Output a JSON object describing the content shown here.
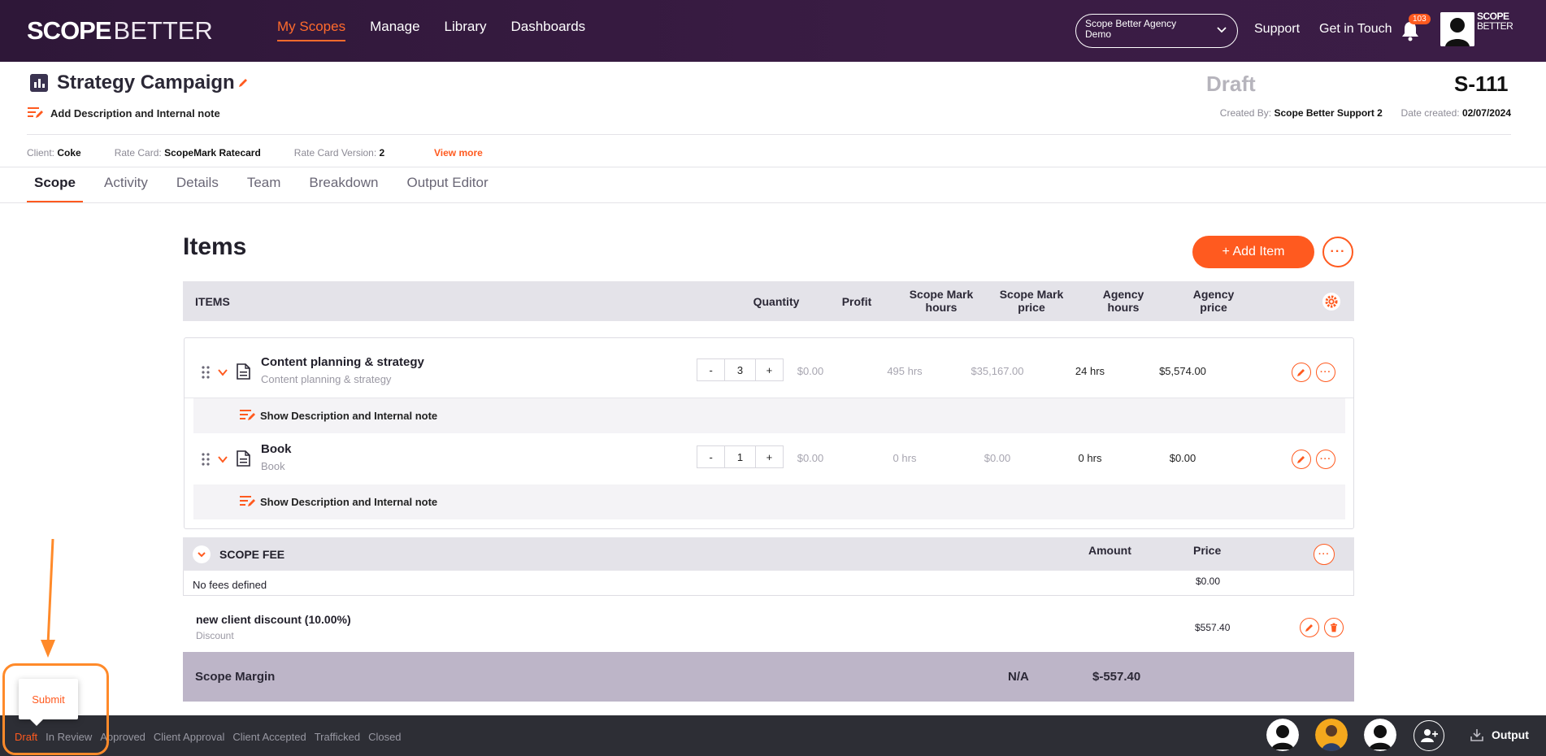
{
  "brand": {
    "logo_main": "SCOPE",
    "logo_rest": "BETTER",
    "mini_line1": "SCOPE",
    "mini_line2": "BETTER"
  },
  "nav": [
    {
      "label": "My Scopes",
      "active": true
    },
    {
      "label": "Manage"
    },
    {
      "label": "Library"
    },
    {
      "label": "Dashboards"
    }
  ],
  "header_right": {
    "agency": "Scope Better Agency Demo",
    "support": "Support",
    "get_in_touch": "Get in Touch",
    "notification_count": "103"
  },
  "scope": {
    "title": "Strategy Campaign",
    "add_description": "Add Description and Internal note",
    "status": "Draft",
    "id": "S-111",
    "created_by_label": "Created By:",
    "created_by": "Scope Better Support 2",
    "date_created_label": "Date created:",
    "date_created": "02/07/2024",
    "client_label": "Client:",
    "client": "Coke",
    "rate_card_label": "Rate Card:",
    "rate_card": "ScopeMark Ratecard",
    "rate_card_version_label": "Rate Card Version:",
    "rate_card_version": "2",
    "view_more": "View more"
  },
  "tabs": [
    {
      "label": "Scope",
      "active": true
    },
    {
      "label": "Activity"
    },
    {
      "label": "Details"
    },
    {
      "label": "Team"
    },
    {
      "label": "Breakdown"
    },
    {
      "label": "Output Editor"
    }
  ],
  "items_section": {
    "title": "Items",
    "add_item": "+ Add Item",
    "columns": {
      "items": "ITEMS",
      "quantity": "Quantity",
      "profit": "Profit",
      "sm_hours": "Scope Mark hours",
      "sm_price": "Scope Mark price",
      "agency_hours": "Agency hours",
      "agency_price": "Agency price"
    },
    "rows": [
      {
        "name": "Content planning & strategy",
        "sub": "Content planning & strategy",
        "minus": "-",
        "qty": "3",
        "plus": "+",
        "profit": "$0.00",
        "sm_hours": "495 hrs",
        "sm_price": "$35,167.00",
        "agency_hours": "24 hrs",
        "agency_price": "$5,574.00",
        "desc_toggle": "Show Description and Internal note"
      },
      {
        "name": "Book",
        "sub": "Book",
        "minus": "-",
        "qty": "1",
        "plus": "+",
        "profit": "$0.00",
        "sm_hours": "0 hrs",
        "sm_price": "$0.00",
        "agency_hours": "0 hrs",
        "agency_price": "$0.00",
        "desc_toggle": "Show Description and Internal note"
      }
    ]
  },
  "fee": {
    "title": "SCOPE FEE",
    "amount_label": "Amount",
    "price_label": "Price",
    "empty": "No fees defined",
    "total": "$0.00"
  },
  "discount": {
    "name": "new client discount (10.00%)",
    "type": "Discount",
    "price": "$557.40"
  },
  "margin": {
    "label": "Scope Margin",
    "pct": "N/A",
    "value": "$-557.40"
  },
  "workflow": {
    "steps": [
      "Draft",
      "In Review",
      "Approved",
      "Client Approval",
      "Client Accepted",
      "Trafficked",
      "Closed"
    ],
    "active": "Draft",
    "submit": "Submit",
    "output": "Output"
  },
  "colors": {
    "accent": "#ff5a1f",
    "topbar": "#3a1c44",
    "bottombar": "#2d2e35",
    "margin_bar": "#bdb5c8",
    "annotation": "#ff8a2a"
  }
}
